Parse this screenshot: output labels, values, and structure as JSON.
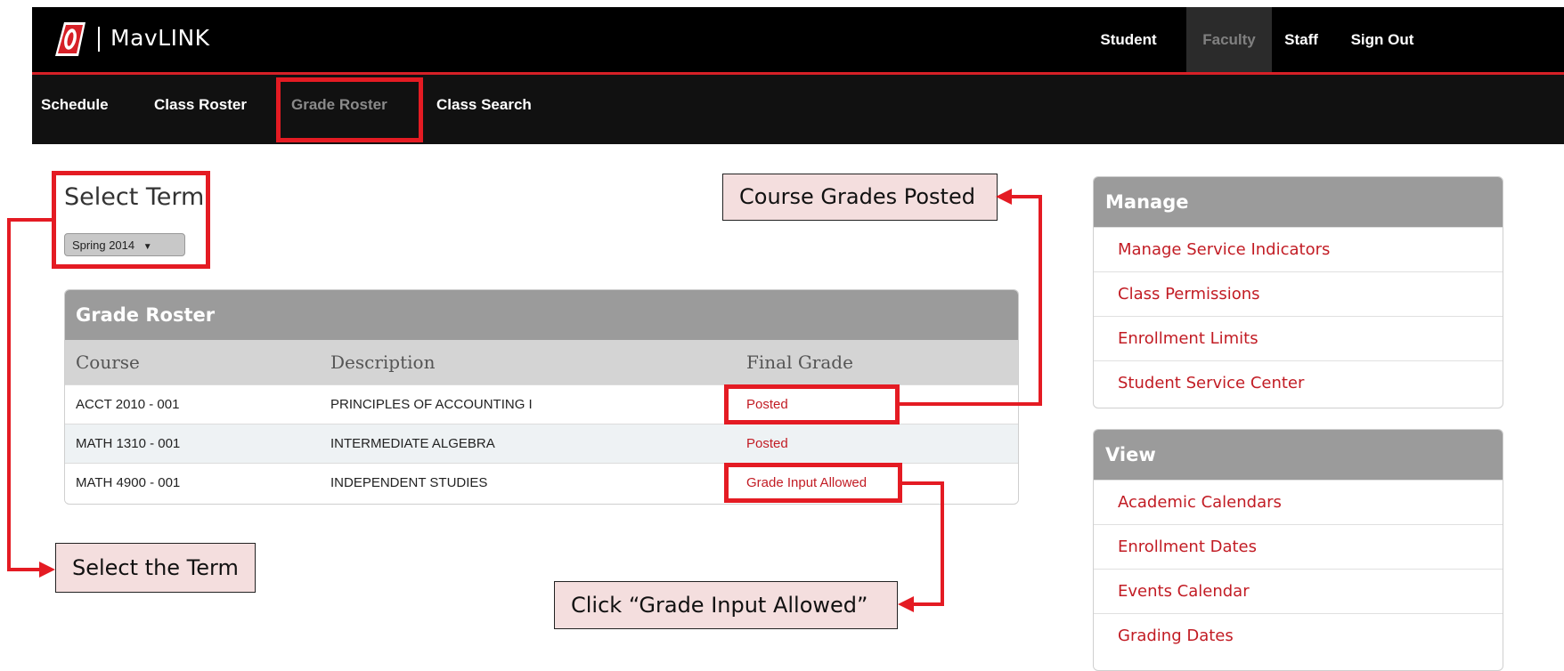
{
  "header": {
    "app_title": "MavLINK",
    "nav": [
      "Student",
      "Faculty",
      "Staff",
      "Sign Out"
    ],
    "active": "Faculty"
  },
  "subnav": [
    "Schedule",
    "Class Roster",
    "Grade Roster",
    "Class Search"
  ],
  "select_term": {
    "title": "Select Term",
    "selected": "Spring 2014"
  },
  "roster": {
    "title": "Grade Roster",
    "columns": [
      "Course",
      "Description",
      "Final Grade"
    ],
    "rows": [
      {
        "course": "ACCT 2010 - 001",
        "description": "PRINCIPLES OF ACCOUNTING I",
        "grade": "Posted"
      },
      {
        "course": "MATH 1310 - 001",
        "description": "INTERMEDIATE ALGEBRA",
        "grade": "Posted"
      },
      {
        "course": "MATH 4900 - 001",
        "description": "INDEPENDENT STUDIES",
        "grade": "Grade Input Allowed"
      }
    ]
  },
  "manage": {
    "title": "Manage",
    "links": [
      "Manage Service Indicators",
      "Class Permissions",
      "Enrollment Limits",
      "Student Service Center"
    ]
  },
  "view": {
    "title": "View",
    "links": [
      "Academic Calendars",
      "Enrollment Dates",
      "Events Calendar",
      "Grading Dates"
    ]
  },
  "callouts": {
    "posted": "Course Grades Posted",
    "term": "Select the Term",
    "input": "Click “Grade Input Allowed”"
  },
  "colors": {
    "accent_red": "#e41b23",
    "link_red": "#c21c24",
    "header_black": "#000000",
    "panel_gray": "#9b9b9b",
    "callout_bg": "#f4dede"
  }
}
